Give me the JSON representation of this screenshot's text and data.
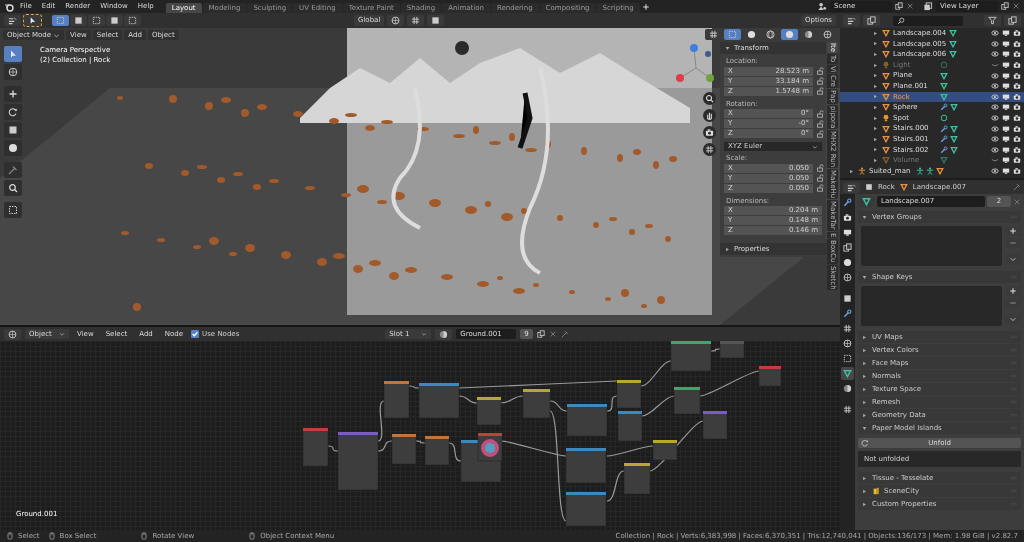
{
  "top_bar": {
    "menus": [
      "File",
      "Edit",
      "Render",
      "Window",
      "Help"
    ],
    "workspaces": [
      {
        "label": "Layout",
        "selected": true
      },
      {
        "label": "Modeling",
        "selected": false
      },
      {
        "label": "Sculpting",
        "selected": false
      },
      {
        "label": "UV Editing",
        "selected": false
      },
      {
        "label": "Texture Paint",
        "selected": false
      },
      {
        "label": "Shading",
        "selected": false
      },
      {
        "label": "Animation",
        "selected": false
      },
      {
        "label": "Rendering",
        "selected": false
      },
      {
        "label": "Compositing",
        "selected": false
      },
      {
        "label": "Scripting",
        "selected": false
      }
    ],
    "scene": "Scene",
    "view_layer": "View Layer"
  },
  "viewport": {
    "orientation": "Global",
    "options": "Options",
    "mode": "Object Mode",
    "menus": [
      "View",
      "Select",
      "Add",
      "Object"
    ],
    "overlay_text": [
      "Camera Perspective",
      "(2) Collection | Rock"
    ],
    "tools": [
      {
        "selected": true
      },
      {
        "selected": false
      },
      {
        "selected": false
      },
      {
        "selected": false
      },
      {
        "selected": false
      },
      {
        "selected": false
      },
      {
        "selected": false
      },
      {
        "selected": false
      },
      {
        "selected": false
      }
    ],
    "sidebar": {
      "tabs": [
        {
          "label": "Ite",
          "selected": true
        },
        {
          "label": "To",
          "selected": false
        },
        {
          "label": "Vi",
          "selected": false
        },
        {
          "label": "Cre",
          "selected": false
        },
        {
          "label": "Pap",
          "selected": false
        },
        {
          "label": "pipora",
          "selected": false
        },
        {
          "label": "MHX2 Run",
          "selected": false
        },
        {
          "label": "MakeHu",
          "selected": false
        },
        {
          "label": "MakeTar",
          "selected": false
        },
        {
          "label": "E",
          "selected": false
        },
        {
          "label": "BoxCu",
          "selected": false
        },
        {
          "label": "Sketch",
          "selected": false
        }
      ],
      "title": "Transform",
      "rows": [
        {
          "kind": "vector",
          "label": "Location:",
          "lockable": true,
          "fields": [
            {
              "axis": "X",
              "value": "28.523 m"
            },
            {
              "axis": "Y",
              "value": "33.184 m"
            },
            {
              "axis": "Z",
              "value": "1.5748 m"
            }
          ]
        },
        {
          "kind": "vector",
          "label": "Rotation:",
          "lockable": true,
          "fields": [
            {
              "axis": "X",
              "value": "0°"
            },
            {
              "axis": "Y",
              "value": "-0°"
            },
            {
              "axis": "Z",
              "value": "0°"
            }
          ]
        },
        {
          "kind": "dropdown",
          "value": "XYZ Euler"
        },
        {
          "kind": "vector",
          "label": "Scale:",
          "lockable": true,
          "fields": [
            {
              "axis": "X",
              "value": "0.050"
            },
            {
              "axis": "Y",
              "value": "0.050"
            },
            {
              "axis": "Z",
              "value": "0.050"
            }
          ]
        },
        {
          "kind": "vector",
          "label": "Dimensions:",
          "lockable": false,
          "fields": [
            {
              "axis": "X",
              "value": "0.204 m"
            },
            {
              "axis": "Y",
              "value": "0.148 m"
            },
            {
              "axis": "Z",
              "value": "0.146 m"
            }
          ]
        }
      ],
      "collapsed_panel": "Properties"
    }
  },
  "node_editor": {
    "type": "Object",
    "menus": [
      "View",
      "Select",
      "Add",
      "Node"
    ],
    "use_nodes": {
      "label": "Use Nodes",
      "checked": true
    },
    "slot": "Slot 1",
    "material": "Ground.001",
    "users": "9",
    "canvas_label": "Ground.001"
  },
  "outliner": {
    "rows": [
      {
        "children": [
          {
            "name": "Landscape.004",
            "kind": "mesh",
            "selected": false,
            "disabled": false,
            "hidden": false,
            "modifier": false
          },
          {
            "name": "Landscape.005",
            "kind": "mesh",
            "selected": false,
            "disabled": false,
            "hidden": false,
            "modifier": false
          },
          {
            "name": "Landscape.006",
            "kind": "mesh",
            "selected": false,
            "disabled": false,
            "hidden": false,
            "modifier": false
          },
          {
            "name": "Light",
            "kind": "light",
            "selected": false,
            "disabled": true,
            "hidden": true,
            "modifier": false
          },
          {
            "name": "Plane",
            "kind": "mesh",
            "selected": false,
            "disabled": false,
            "hidden": false,
            "modifier": false
          },
          {
            "name": "Plane.001",
            "kind": "mesh",
            "selected": false,
            "disabled": false,
            "hidden": false,
            "modifier": false
          },
          {
            "name": "Rock",
            "kind": "mesh",
            "selected": true,
            "disabled": false,
            "hidden": false,
            "modifier": false
          },
          {
            "name": "Sphere",
            "kind": "mesh",
            "selected": false,
            "disabled": false,
            "hidden": false,
            "modifier": true
          },
          {
            "name": "Spot",
            "kind": "light",
            "selected": false,
            "disabled": false,
            "hidden": false,
            "modifier": false
          },
          {
            "name": "Stairs.000",
            "kind": "mesh",
            "selected": false,
            "disabled": false,
            "hidden": false,
            "modifier": true
          },
          {
            "name": "Stairs.001",
            "kind": "mesh",
            "selected": false,
            "disabled": false,
            "hidden": false,
            "modifier": true
          },
          {
            "name": "Stairs.002",
            "kind": "mesh",
            "selected": false,
            "disabled": false,
            "hidden": false,
            "modifier": true
          },
          {
            "name": "Volume",
            "kind": "mesh",
            "selected": false,
            "disabled": true,
            "hidden": true,
            "modifier": false
          }
        ]
      },
      {
        "name": "Suited_man",
        "kind": "armature",
        "selected": false,
        "disabled": false,
        "hidden": false,
        "modifier": false
      }
    ]
  },
  "properties": {
    "object": "Rock",
    "data": "Landscape.007",
    "datablock": "Landscape.007",
    "users": "2",
    "tabs": [
      {
        "kind": "tool",
        "selected": false
      },
      {
        "kind": "render",
        "selected": false
      },
      {
        "kind": "output",
        "selected": false
      },
      {
        "kind": "view_layer",
        "selected": false
      },
      {
        "kind": "scene",
        "selected": false
      },
      {
        "kind": "world",
        "selected": false
      },
      {
        "kind": "object",
        "selected": false
      },
      {
        "kind": "modifiers",
        "selected": false
      },
      {
        "kind": "particles",
        "selected": false
      },
      {
        "kind": "physics",
        "selected": false
      },
      {
        "kind": "constraints",
        "selected": false
      },
      {
        "kind": "data",
        "selected": true
      },
      {
        "kind": "material",
        "selected": false
      },
      {
        "kind": "texture",
        "selected": false
      }
    ],
    "panels": [
      {
        "title": "Vertex Groups",
        "expanded": true,
        "kind": "list"
      },
      {
        "title": "Shape Keys",
        "expanded": true,
        "kind": "list"
      },
      {
        "title": "UV Maps",
        "expanded": false,
        "kind": "plain"
      },
      {
        "title": "Vertex Colors",
        "expanded": false,
        "kind": "plain"
      },
      {
        "title": "Face Maps",
        "expanded": false,
        "kind": "plain"
      },
      {
        "title": "Normals",
        "expanded": false,
        "kind": "plain"
      },
      {
        "title": "Texture Space",
        "expanded": false,
        "kind": "plain"
      },
      {
        "title": "Remesh",
        "expanded": false,
        "kind": "plain"
      },
      {
        "title": "Geometry Data",
        "expanded": false,
        "kind": "plain"
      },
      {
        "title": "Paper Model Islands",
        "expanded": true,
        "kind": "unfold",
        "button": "Unfold",
        "status": "Not unfolded"
      },
      {
        "title": "Tissue - Tesselate",
        "expanded": false,
        "kind": "plain"
      },
      {
        "title": "SceneCity",
        "expanded": false,
        "kind": "addon"
      },
      {
        "title": "Custom Properties",
        "expanded": false,
        "kind": "plain"
      }
    ]
  },
  "status_bar": {
    "hints": [
      "Select",
      "Box Select",
      "Rotate View",
      "Object Context Menu"
    ],
    "stats": "Collection | Rock | Verts:6,383,998 | Faces:6,370,351 | Tris:12,740,041 | Objects:136/173 | Mem: 1.98 GiB | v2.82.7"
  }
}
